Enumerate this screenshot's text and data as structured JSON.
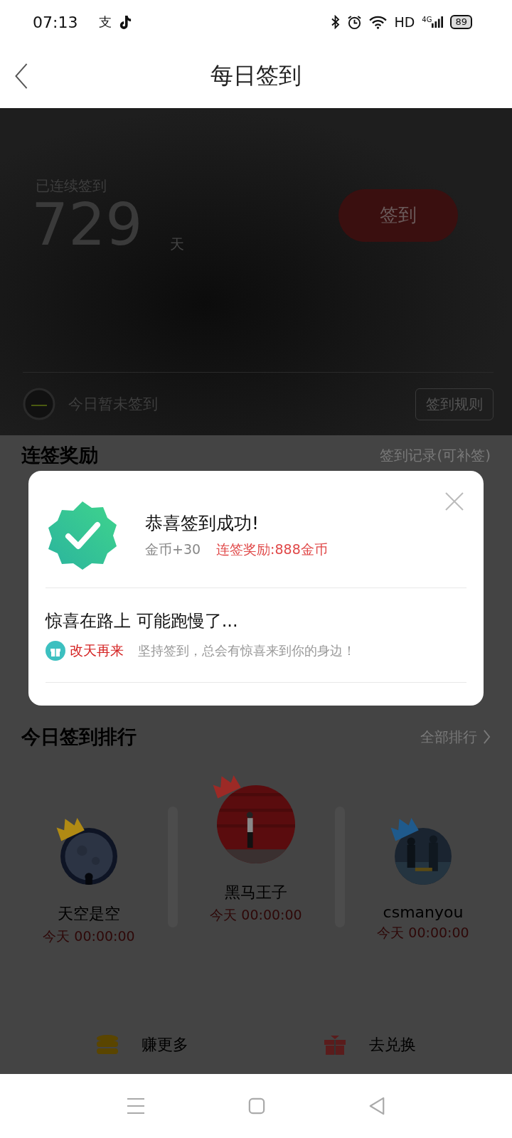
{
  "status_bar": {
    "time": "07:13",
    "app_glyph": "支",
    "network_label": "HD",
    "network_type": "4G",
    "battery": "89"
  },
  "header": {
    "title": "每日签到"
  },
  "streak": {
    "label": "已连续签到",
    "days": "729",
    "unit": "天",
    "sign_button": "签到",
    "status": "今日暂未签到",
    "rules_button": "签到规则"
  },
  "reward_section": {
    "title": "连签奖励",
    "link": "签到记录(可补签)"
  },
  "dialog": {
    "title": "恭喜签到成功!",
    "coins": "金币+30",
    "bonus": "连签奖励:888金币",
    "subtitle": "惊喜在路上 可能跑慢了...",
    "tag": "改天再来",
    "message": "坚持签到，总会有惊喜来到你的身边！"
  },
  "ranking": {
    "title": "今日签到排行",
    "link": "全部排行",
    "users": [
      {
        "kind": "second",
        "color": "#b08a14",
        "name": "天空是空",
        "time": "今天 00:00:00"
      },
      {
        "kind": "first",
        "color": "#9c2a26",
        "name": "黑马王子",
        "time": "今天 00:00:00"
      },
      {
        "kind": "third",
        "color": "#1f5a8c",
        "name": "csmanyou",
        "time": "今天 00:00:00"
      }
    ]
  },
  "actions": [
    {
      "kind": "coins",
      "label": "赚更多"
    },
    {
      "kind": "gift",
      "label": "去兑换"
    }
  ]
}
